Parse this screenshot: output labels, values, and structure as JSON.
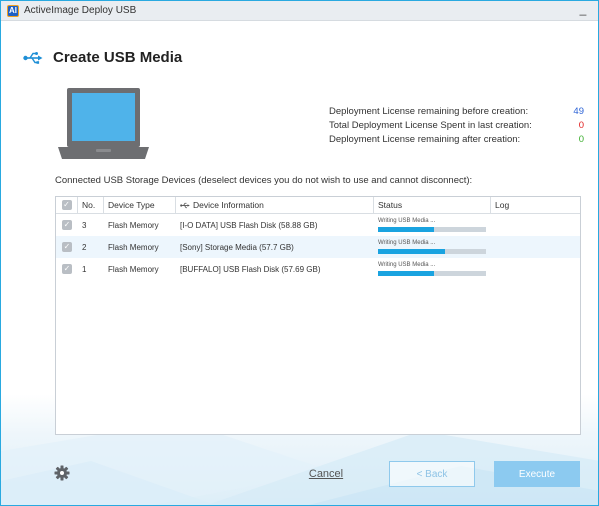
{
  "window": {
    "app_icon_text": "AI",
    "title": "ActiveImage Deploy USB",
    "minimize_label": "_"
  },
  "header": {
    "title": "Create USB Media"
  },
  "license": {
    "rows": [
      {
        "label": "Deployment License remaining before creation:",
        "value": "49",
        "color": "#2d64d6"
      },
      {
        "label": "Total Deployment License Spent in last creation:",
        "value": "0",
        "color": "#e02020"
      },
      {
        "label": "Deployment License remaining after creation:",
        "value": "0",
        "color": "#3cae2e"
      }
    ]
  },
  "devices_caption": "Connected USB Storage Devices (deselect devices you do not wish to use and cannot disconnect):",
  "table": {
    "headers": {
      "no": "No.",
      "type": "Device Type",
      "info": "Device Information",
      "status": "Status",
      "log": "Log"
    },
    "rows": [
      {
        "no": "3",
        "type": "Flash Memory",
        "info": "[I-O DATA] USB Flash Disk (58.88 GB)",
        "status": "Writing USB Media ...",
        "progress": 0.52,
        "log": ""
      },
      {
        "no": "2",
        "type": "Flash Memory",
        "info": "[Sony] Storage Media (57.7 GB)",
        "status": "Writing USB Media ...",
        "progress": 0.62,
        "log": ""
      },
      {
        "no": "1",
        "type": "Flash Memory",
        "info": "[BUFFALO] USB Flash Disk (57.69 GB)",
        "status": "Writing USB Media ...",
        "progress": 0.52,
        "log": ""
      }
    ]
  },
  "footer": {
    "cancel_label": "Cancel",
    "back_label": "< Back",
    "execute_label": "Execute"
  },
  "colors": {
    "accent": "#29a9e0",
    "progress": "#1aa3e0",
    "execute_bg": "#8ccaf0"
  },
  "icons": [
    "usb-icon",
    "laptop-icon",
    "checkbox-icon",
    "gear-icon",
    "minimize-icon",
    "app-icon"
  ]
}
